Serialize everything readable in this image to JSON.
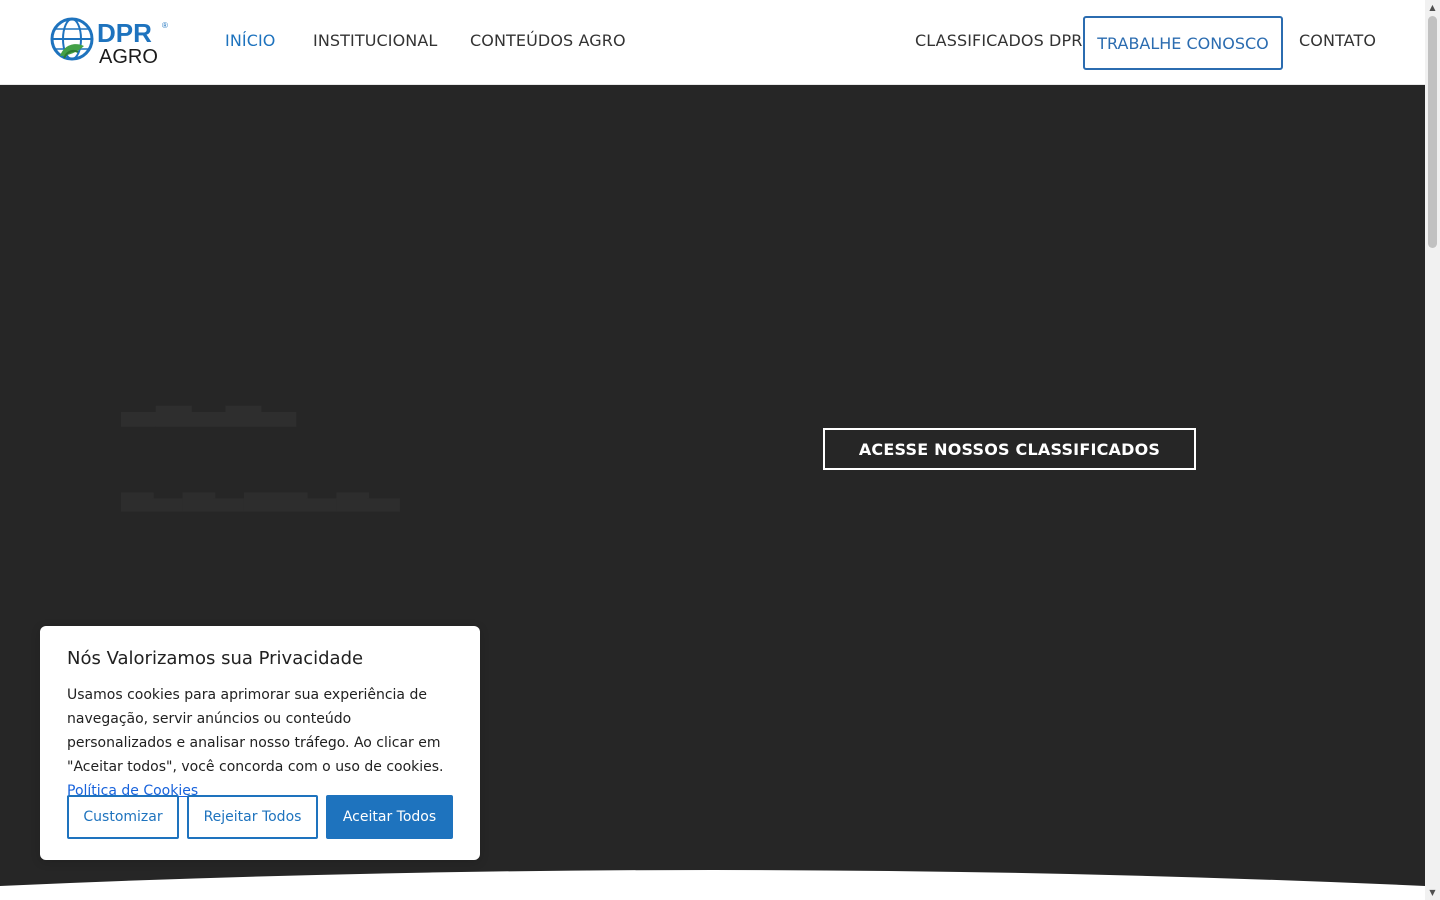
{
  "header": {
    "logo": {
      "main": "DPR",
      "sub": "AGRO",
      "mark": "®"
    },
    "nav_left": [
      {
        "label": "INÍCIO",
        "active": true
      },
      {
        "label": "INSTITUCIONAL"
      },
      {
        "label": "CONTEÚDOS AGRO"
      }
    ],
    "nav_right": [
      {
        "label": "CLASSIFICADOS DPR"
      },
      {
        "label": "TRABALHE CONOSCO"
      },
      {
        "label": "CONTATO"
      }
    ]
  },
  "hero": {
    "button_label": "ACESSE NOSSOS CLASSIFICADOS"
  },
  "cookie_banner": {
    "title": "Nós Valorizamos sua Privacidade",
    "text": "Usamos cookies para aprimorar sua experiência de navegação, servir anúncios ou conteúdo personalizados e analisar nosso tráfego. Ao clicar em \"Aceitar todos\", você concorda com o uso de cookies.",
    "policy_link": "Política de Cookies",
    "buttons": {
      "customize": "Customizar",
      "reject": "Rejeitar Todos",
      "accept": "Aceitar Todos"
    }
  },
  "colors": {
    "accent": "#1e73be",
    "hero_bg": "#262626",
    "logo_blue": "#1e73be",
    "logo_green": "#43a047"
  },
  "icons": {
    "logo_globe": "globe-leaf-icon",
    "scroll_up": "triangle-up-icon",
    "scroll_down": "triangle-down-icon"
  }
}
